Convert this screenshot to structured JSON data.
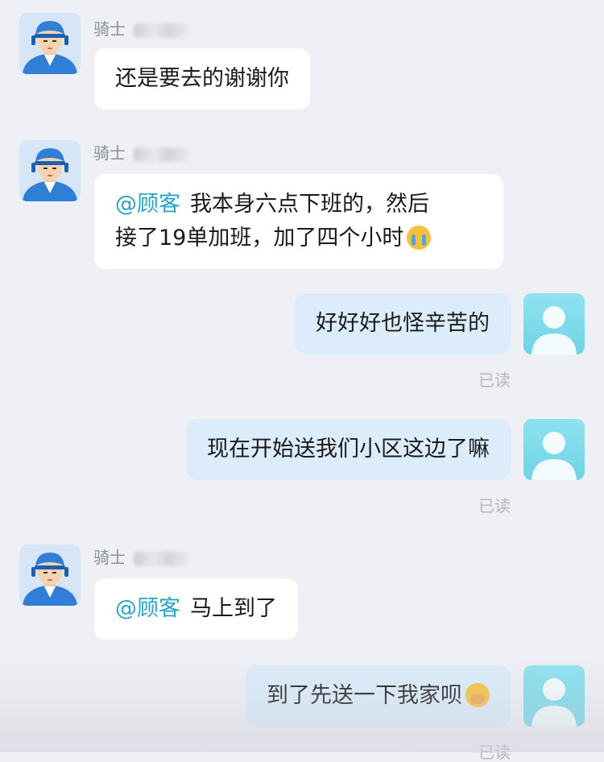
{
  "messages": [
    {
      "sender": "rider",
      "name": "骑士",
      "text": "还是要去的谢谢你"
    },
    {
      "sender": "rider",
      "name": "骑士",
      "mention": "@顾客",
      "line1": "我本身六点下班的，然后",
      "line2": "接了19单加班，加了四个小时",
      "emoji": "crying-face"
    },
    {
      "sender": "me",
      "text": "好好好也怪辛苦的",
      "status": "已读"
    },
    {
      "sender": "me",
      "text": "现在开始送我们小区这边了嘛",
      "status": "已读"
    },
    {
      "sender": "rider",
      "name": "骑士",
      "mention": "@顾客",
      "text": "马上到了"
    },
    {
      "sender": "me",
      "text": "到了先送一下我家呗",
      "emoji": "hand-over-mouth-face",
      "status": "已读"
    }
  ],
  "colors": {
    "background": "#eef0f5",
    "incoming_bubble": "#ffffff",
    "outgoing_bubble": "#dcecfb",
    "mention": "#2aa3c8",
    "read_status": "#b3b6bc"
  }
}
